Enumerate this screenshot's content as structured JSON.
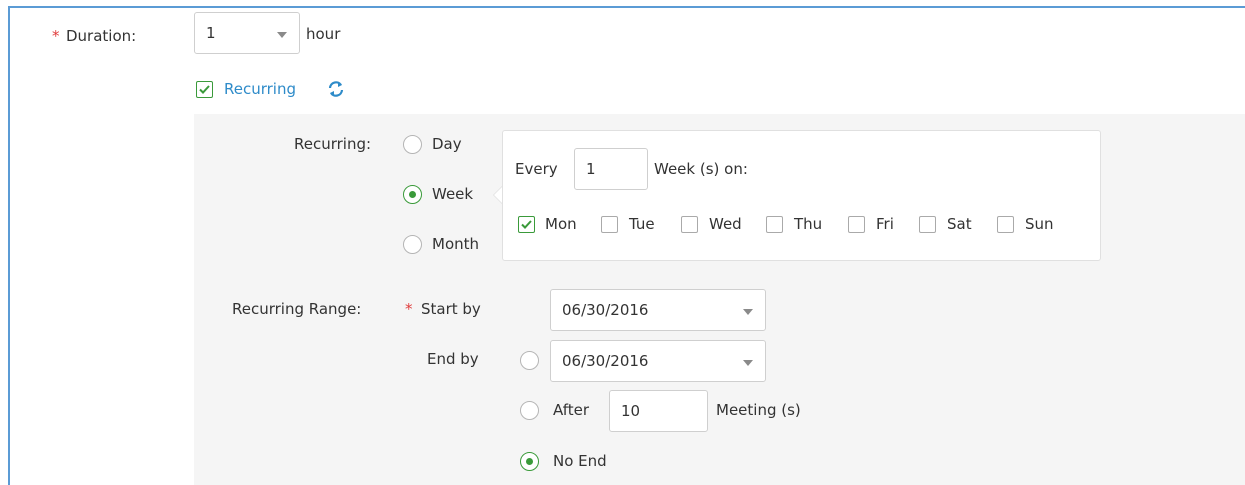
{
  "duration": {
    "label": "Duration:",
    "required_mark": "*",
    "value": "1",
    "unit": "hour"
  },
  "recurring_toggle": {
    "label": "Recurring",
    "checked": true,
    "icon": "refresh-icon"
  },
  "recurring": {
    "label": "Recurring:",
    "options": [
      "Day",
      "Week",
      "Month"
    ],
    "selected": "Week",
    "every_label": "Every",
    "every_value": "1",
    "unit_label": "Week (s) on:",
    "days": [
      {
        "label": "Mon",
        "checked": true
      },
      {
        "label": "Tue",
        "checked": false
      },
      {
        "label": "Wed",
        "checked": false
      },
      {
        "label": "Thu",
        "checked": false
      },
      {
        "label": "Fri",
        "checked": false
      },
      {
        "label": "Sat",
        "checked": false
      },
      {
        "label": "Sun",
        "checked": false
      }
    ]
  },
  "range": {
    "label": "Recurring Range:",
    "required_mark": "*",
    "start_label": "Start by",
    "start_value": "06/30/2016",
    "end_label": "End by",
    "end_value": "06/30/2016",
    "after_label": "After",
    "after_value": "10",
    "meeting_label": "Meeting (s)",
    "no_end_label": "No End",
    "selected": "No End"
  },
  "colors": {
    "accent": "#3a9a3a",
    "link": "#2e8bc9",
    "required": "#e03c3c",
    "frame": "#5b9bd5"
  }
}
